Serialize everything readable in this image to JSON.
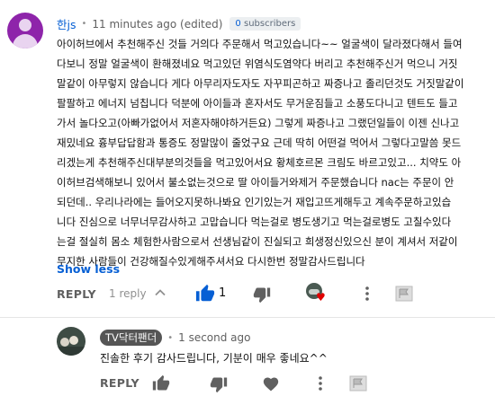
{
  "comment": {
    "author": "한js",
    "time": "11 minutes ago (edited)",
    "subscribers_count": "0",
    "subscribers_label": "subscribers",
    "text": "아이허브에서 추천해주신 것들 거의다 주문해서 먹고있습니다~~  얼굴색이 달라졌다해서 들여\n다보니 정말 얼굴색이 환해졌네요 먹고있던 위염식도염약다 버리고 추천해주신거 먹으니 거짓\n말같이 아무렇지 않습니다 게다 아무리자도자도 자꾸피곤하고 짜증나고 졸리던것도 거짓말같이\n팔팔하고 에너지 넘칩니다 덕분에 아이들과 혼자서도 무거운짐들고 소풍도다니고 텐트도 들고\n가서 놀다오고(아빠가없어서 저혼자해야하거든요) 그렇게 짜증나고 그랬던일들이 이젠  신나고\n재밌네요 흉부답답함과 통증도 정말많이 줄었구요 근데 딱히 어떤걸 먹어서 그렇다고말씀 못드\n리겠는게 추천해주신대부분의것들을 먹고있어서요 황체호르몬 크림도 바르고있고...  치약도 아\n이허브검색해보니 있어서 불소없는것으로 딸 아이들거와제거 주문했습니다  nac는 주문이 안\n되던데..  우리나라에는 들어오지못하나봐요  인기있는거 재입고뜨게해두고 계속주문하고있습\n니다  진심으로 너무너무감사하고 고맙습니다  먹는걸로 병도생기고 먹는걸로병도 고칠수있다\n는걸 절실히 몸소 체험한사람으로서 선생님같이 진실되고 희생정신있으신 분이 계셔서 저같이\n무지한 사람들이 건강해질수있게해주셔서요 다시한번 정말감사드립니다",
    "show_less": "Show less",
    "reply_label": "REPLY",
    "reply_count": "1 reply",
    "like_count": "1",
    "icons": {
      "chevron": "chevron-up-icon",
      "like": "thumbs-up-filled-icon",
      "dislike": "thumbs-down-icon",
      "creator_heart": "creator-heart-icon",
      "more": "more-vert-icon",
      "flag": "flag-icon"
    },
    "colors": {
      "link": "#065fd4",
      "avatar": "#8e24aa",
      "heart": "#e00000"
    }
  },
  "reply": {
    "author": "TV닥터팬더",
    "time": "1 second ago",
    "text": "진솔한 후기 감사드립니다, 기분이 매우 좋네요^^",
    "reply_label": "REPLY",
    "icons": {
      "like": "thumbs-up-icon",
      "dislike": "thumbs-down-icon",
      "heart": "heart-icon",
      "more": "more-vert-icon",
      "flag": "flag-icon"
    }
  }
}
